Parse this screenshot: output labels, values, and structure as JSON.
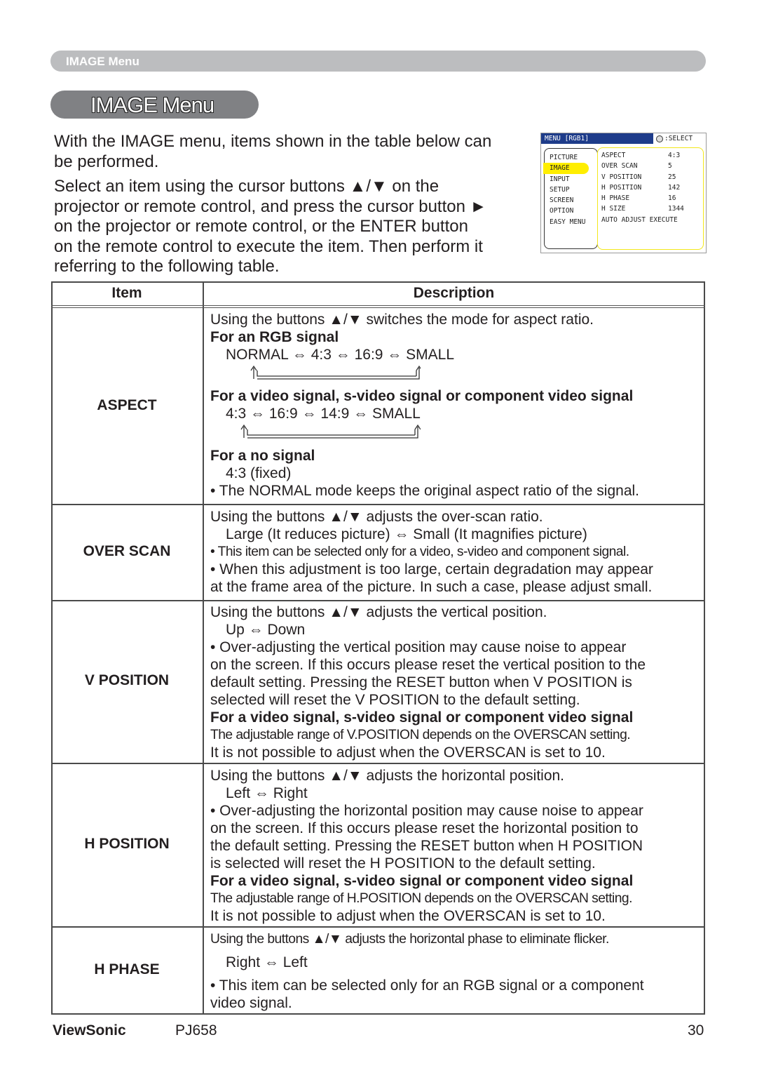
{
  "header": {
    "section_bar": "IMAGE Menu",
    "page_title": "IMAGE Menu"
  },
  "intro": {
    "paragraph1": [
      "With the IMAGE menu, items shown in the table below can",
      "be performed."
    ],
    "paragraph2": [
      "Select an item using the cursor buttons ▲/▼ on the",
      "projector or remote control, and press the cursor button ►",
      "on the projector or remote control, or the ENTER button",
      "on the remote control to execute the item. Then perform it",
      "referring to the following table."
    ]
  },
  "osd": {
    "menu_title": "MENU [RGB1]",
    "select_label": ":SELECT",
    "select_icon": "cursor-pad-icon",
    "left_items": [
      "PICTURE",
      "IMAGE",
      "INPUT",
      "SETUP",
      "SCREEN",
      "OPTION",
      "EASY MENU"
    ],
    "active_item": "IMAGE",
    "right_items": [
      {
        "label": "ASPECT",
        "value": "4:3"
      },
      {
        "label": "OVER SCAN",
        "value": "5"
      },
      {
        "label": "V POSITION",
        "value": "25"
      },
      {
        "label": "H POSITION",
        "value": "142"
      },
      {
        "label": "H PHASE",
        "value": "16"
      },
      {
        "label": "H SIZE",
        "value": "1344"
      },
      {
        "label": "AUTO ADJUST EXECUTE",
        "value": ""
      }
    ],
    "colors": {
      "header_bg": "#1e3c8a",
      "highlight": "#ffee00"
    }
  },
  "table": {
    "headers": {
      "item": "Item",
      "description": "Description"
    },
    "aspect": {
      "item": "ASPECT",
      "line1": "Using the buttons ▲/▼ switches the mode for aspect ratio.",
      "rgb_heading": "For an RGB signal",
      "rgb_cycle": "NORMAL ⇔ 4:3 ⇔ 16:9 ⇔ SMALL",
      "video_heading": "For a video signal, s-video signal or component video signal",
      "video_cycle": "4:3 ⇔ 16:9 ⇔ 14:9 ⇔ SMALL",
      "nosignal_heading": "For a no signal",
      "nosignal_value": "4:3 (fixed)",
      "note": "• The NORMAL mode keeps the original aspect ratio of the signal."
    },
    "overscan": {
      "item": "OVER SCAN",
      "line1": "Using the buttons ▲/▼ adjusts the over-scan ratio.",
      "cycle": "Large (It reduces picture) ⇔ Small (It magnifies picture)",
      "note1": "• This item can be selected only for a video, s-video and component signal.",
      "note2a": "• When this adjustment is too large, certain degradation may appear",
      "note2b": "at the frame area of the picture. In such a case, please adjust small."
    },
    "vposition": {
      "item": "V POSITION",
      "line1": "Using the buttons ▲/▼ adjusts the vertical position.",
      "cycle": "Up ⇔ Down",
      "note": [
        "• Over-adjusting the vertical position may cause noise to appear",
        "on the screen. If this occurs please reset the vertical position to the",
        "default setting. Pressing the RESET button when V POSITION is",
        "selected will reset the V POSITION to the default setting."
      ],
      "video_heading": "For a video signal, s-video signal or component video signal",
      "range_note": "The adjustable range of V.POSITION depends on the OVERSCAN setting.",
      "limit_note": "It is not possible to adjust when the OVERSCAN is set to 10."
    },
    "hposition": {
      "item": "H POSITION",
      "line1": "Using the buttons ▲/▼ adjusts the horizontal position.",
      "cycle": "Left ⇔ Right",
      "note": [
        "• Over-adjusting the horizontal position may cause noise to appear",
        "on the screen. If this occurs please reset the horizontal position to",
        "the default setting. Pressing the RESET button when H POSITION",
        "is selected will reset the H POSITION to the default setting."
      ],
      "video_heading": "For a video signal, s-video signal or component video signal",
      "range_note": "The adjustable range of H.POSITION depends on the OVERSCAN setting.",
      "limit_note": "It is not possible to adjust when the OVERSCAN is set to 10."
    },
    "hphase": {
      "item": "H PHASE",
      "line1": "Using the buttons ▲/▼ adjusts the horizontal phase to eliminate flicker.",
      "cycle": "Right ⇔ Left",
      "note_a": "• This item can be selected only for an RGB signal or a component",
      "note_b": "video signal."
    }
  },
  "footer": {
    "brand": "ViewSonic",
    "model": "PJ658",
    "page_number": "30"
  }
}
